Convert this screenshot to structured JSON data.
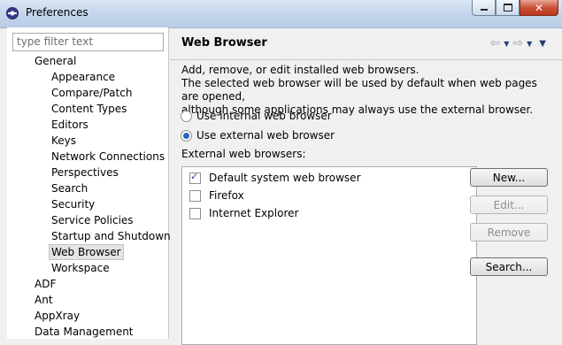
{
  "window": {
    "title": "Preferences",
    "close_glyph": "✕"
  },
  "filter": {
    "placeholder": "type filter text"
  },
  "tree": {
    "items": [
      {
        "label": "General",
        "level": 0
      },
      {
        "label": "Appearance",
        "level": 1
      },
      {
        "label": "Compare/Patch",
        "level": 1
      },
      {
        "label": "Content Types",
        "level": 1
      },
      {
        "label": "Editors",
        "level": 1
      },
      {
        "label": "Keys",
        "level": 1
      },
      {
        "label": "Network Connections",
        "level": 1
      },
      {
        "label": "Perspectives",
        "level": 1
      },
      {
        "label": "Search",
        "level": 1
      },
      {
        "label": "Security",
        "level": 1
      },
      {
        "label": "Service Policies",
        "level": 1
      },
      {
        "label": "Startup and Shutdown",
        "level": 1
      },
      {
        "label": "Web Browser",
        "level": 1,
        "selected": true
      },
      {
        "label": "Workspace",
        "level": 1
      },
      {
        "label": "ADF",
        "level": 0
      },
      {
        "label": "Ant",
        "level": 0
      },
      {
        "label": "AppXray",
        "level": 0
      },
      {
        "label": "Data Management",
        "level": 0
      }
    ]
  },
  "page": {
    "title": "Web Browser",
    "description": [
      "Add, remove, or edit installed web browsers.",
      "The selected web browser will be used by default when web pages are opened,",
      "although some applications may always use the external browser."
    ],
    "radio_internal": "Use internal web browser",
    "radio_external": "Use external web browser",
    "selected_radio": "external",
    "external_label": "External web browsers:",
    "browsers": [
      {
        "label": "Default system web browser",
        "checked": true
      },
      {
        "label": "Firefox",
        "checked": false
      },
      {
        "label": "Internet Explorer",
        "checked": false
      }
    ],
    "buttons": {
      "new": "New...",
      "edit": "Edit...",
      "remove": "Remove",
      "search": "Search..."
    }
  }
}
